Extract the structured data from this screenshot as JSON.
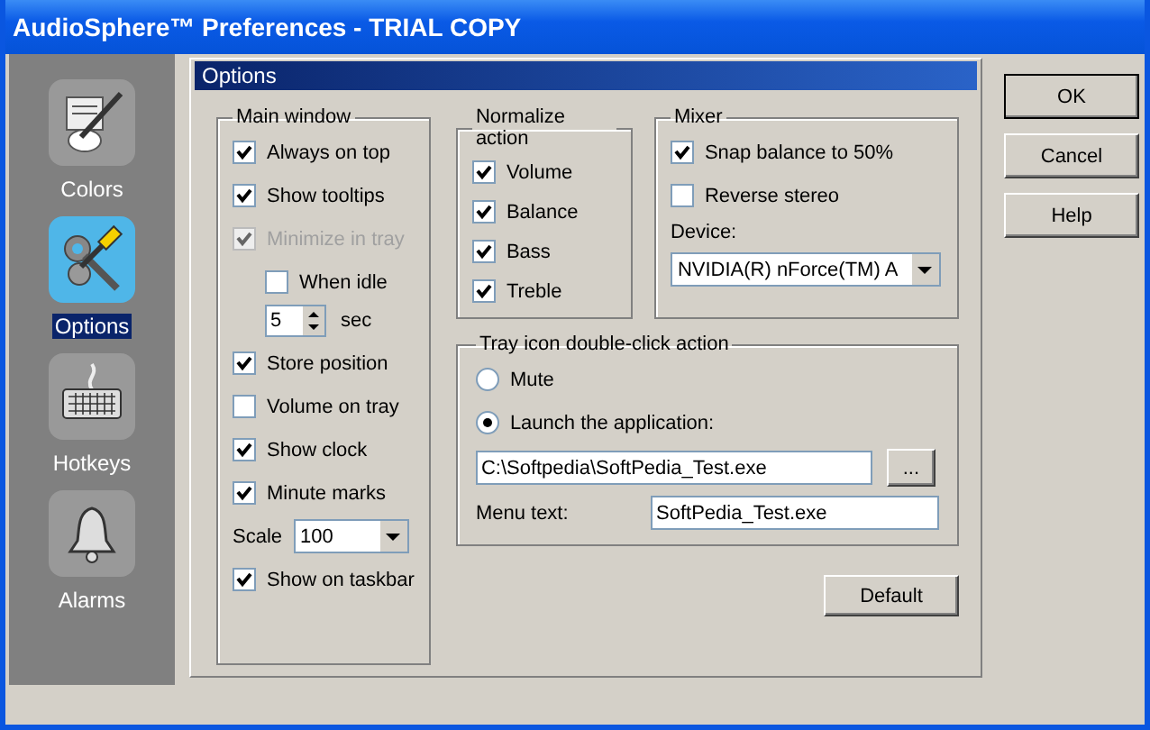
{
  "window": {
    "title": "AudioSphere™ Preferences - TRIAL COPY"
  },
  "sidebar": {
    "items": [
      {
        "label": "Colors",
        "selected": false
      },
      {
        "label": "Options",
        "selected": true
      },
      {
        "label": "Hotkeys",
        "selected": false
      },
      {
        "label": "Alarms",
        "selected": false
      }
    ]
  },
  "panel": {
    "title": "Options",
    "main_window": {
      "title": "Main window",
      "items": [
        {
          "kind": "checkbox",
          "label": "Always on top",
          "checked": true,
          "disabled": false
        },
        {
          "kind": "checkbox",
          "label": "Show tooltips",
          "checked": true,
          "disabled": false
        },
        {
          "kind": "checkbox",
          "label": "Minimize in tray",
          "checked": true,
          "disabled": true,
          "children": [
            {
              "kind": "checkbox",
              "label": "When idle",
              "checked": false,
              "disabled": false
            },
            {
              "kind": "spinner",
              "value": "5",
              "unit": "sec"
            }
          ]
        },
        {
          "kind": "checkbox",
          "label": "Store position",
          "checked": true,
          "disabled": false
        },
        {
          "kind": "checkbox",
          "label": "Volume on tray",
          "checked": false,
          "disabled": false
        },
        {
          "kind": "checkbox",
          "label": "Show clock",
          "checked": true,
          "disabled": false
        },
        {
          "kind": "checkbox",
          "label": "Minute marks",
          "checked": true,
          "disabled": false
        },
        {
          "kind": "dropdown",
          "label": "Scale",
          "value": "100"
        },
        {
          "kind": "checkbox",
          "label": "Show on taskbar",
          "checked": true,
          "disabled": false
        }
      ]
    },
    "normalize": {
      "title": "Normalize action",
      "items": [
        {
          "label": "Volume",
          "checked": true
        },
        {
          "label": "Balance",
          "checked": true
        },
        {
          "label": "Bass",
          "checked": true
        },
        {
          "label": "Treble",
          "checked": true
        }
      ]
    },
    "mixer": {
      "title": "Mixer",
      "items": [
        {
          "label": "Snap balance to 50%",
          "checked": true
        },
        {
          "label": "Reverse stereo",
          "checked": false
        }
      ],
      "device_label": "Device:",
      "device_value": "NVIDIA(R) nForce(TM) A"
    },
    "tray": {
      "title": "Tray icon double-click action",
      "options": [
        {
          "label": "Mute",
          "selected": false
        },
        {
          "label": "Launch the application:",
          "selected": true
        }
      ],
      "path_value": "C:\\Softpedia\\SoftPedia_Test.exe",
      "browse_label": "...",
      "menu_text_label": "Menu text:",
      "menu_text_value": "SoftPedia_Test.exe"
    },
    "default_button": "Default"
  },
  "buttons": [
    "OK",
    "Cancel",
    "Help"
  ]
}
